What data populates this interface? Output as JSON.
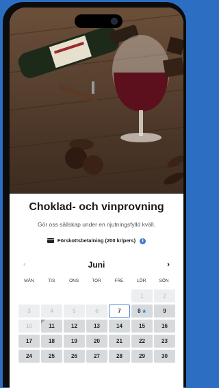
{
  "event": {
    "title": "Choklad- och vinprovning",
    "subtitle": "Gör oss sällskap under en njutningsfylld kväll.",
    "payment_label": "Förskottsbetalning (200 kr/pers)"
  },
  "calendar": {
    "month": "Juni",
    "prev_icon": "‹",
    "next_icon": "›",
    "weekdays": [
      "MÅN",
      "TIS",
      "ONS",
      "TOR",
      "FRE",
      "LÖR",
      "SÖN"
    ],
    "days": [
      {
        "label": "",
        "state": "empty"
      },
      {
        "label": "",
        "state": "empty"
      },
      {
        "label": "",
        "state": "empty"
      },
      {
        "label": "",
        "state": "empty"
      },
      {
        "label": "",
        "state": "empty"
      },
      {
        "label": "1",
        "state": "past"
      },
      {
        "label": "2",
        "state": "past"
      },
      {
        "label": "3",
        "state": "past"
      },
      {
        "label": "4",
        "state": "past"
      },
      {
        "label": "5",
        "state": "past"
      },
      {
        "label": "6",
        "state": "past"
      },
      {
        "label": "7",
        "state": "today"
      },
      {
        "label": "8",
        "state": "avail",
        "star": true
      },
      {
        "label": "9",
        "state": "avail"
      },
      {
        "label": "10",
        "state": "past"
      },
      {
        "label": "11",
        "state": "avail",
        "corner": true
      },
      {
        "label": "12",
        "state": "avail"
      },
      {
        "label": "13",
        "state": "avail"
      },
      {
        "label": "14",
        "state": "avail"
      },
      {
        "label": "15",
        "state": "avail"
      },
      {
        "label": "16",
        "state": "avail"
      },
      {
        "label": "17",
        "state": "avail"
      },
      {
        "label": "18",
        "state": "avail"
      },
      {
        "label": "19",
        "state": "avail"
      },
      {
        "label": "20",
        "state": "avail"
      },
      {
        "label": "21",
        "state": "avail"
      },
      {
        "label": "22",
        "state": "avail"
      },
      {
        "label": "23",
        "state": "avail"
      },
      {
        "label": "24",
        "state": "avail"
      },
      {
        "label": "25",
        "state": "avail"
      },
      {
        "label": "26",
        "state": "avail"
      },
      {
        "label": "27",
        "state": "avail"
      },
      {
        "label": "28",
        "state": "avail"
      },
      {
        "label": "29",
        "state": "avail"
      },
      {
        "label": "30",
        "state": "avail"
      }
    ]
  },
  "colors": {
    "background": "#2c6fc2",
    "accent": "#3a7bd5",
    "available_day": "#d7dadd",
    "past_day": "#eceef0"
  },
  "icons": {
    "info": "i",
    "star": "★"
  }
}
